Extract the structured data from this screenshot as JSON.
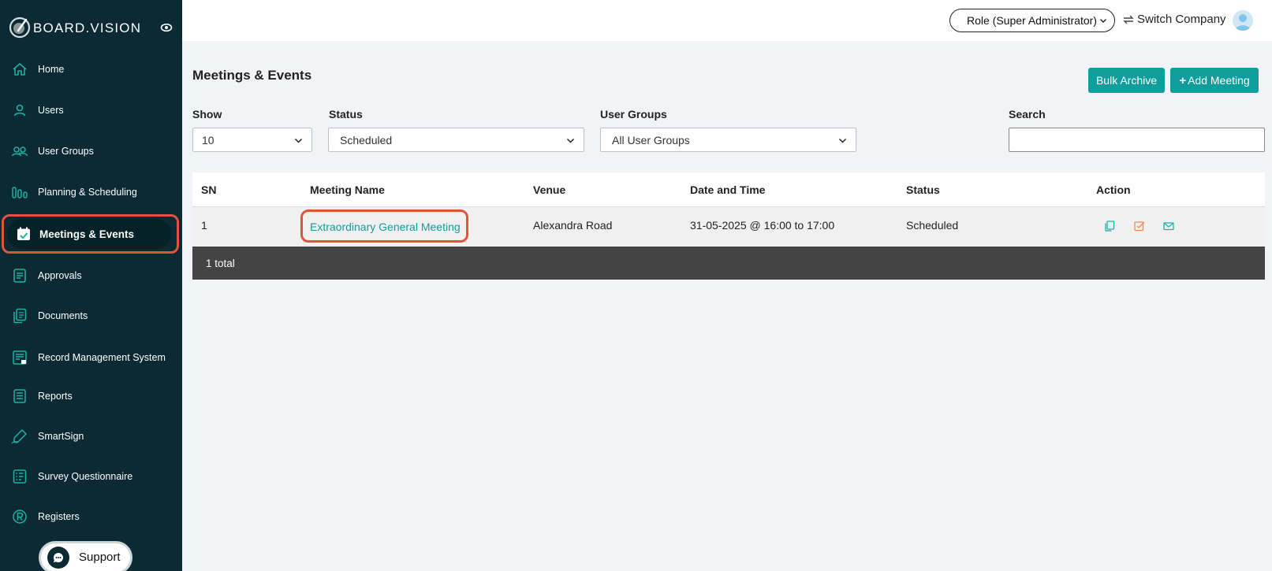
{
  "brand": {
    "name": "BOARD.VISION"
  },
  "sidebar": {
    "items": [
      {
        "label": "Home",
        "icon": "home-icon"
      },
      {
        "label": "Users",
        "icon": "user-icon"
      },
      {
        "label": "User Groups",
        "icon": "user-groups-icon"
      },
      {
        "label": "Planning & Scheduling",
        "icon": "planning-icon"
      },
      {
        "label": "Meetings & Events",
        "icon": "calendar-check-icon",
        "active": true
      },
      {
        "label": "Approvals",
        "icon": "approvals-icon"
      },
      {
        "label": "Documents",
        "icon": "documents-icon"
      },
      {
        "label": "Record Management System",
        "icon": "record-management-icon"
      },
      {
        "label": "Reports",
        "icon": "reports-icon"
      },
      {
        "label": "SmartSign",
        "icon": "smartsign-icon"
      },
      {
        "label": "Survey Questionnaire",
        "icon": "survey-icon"
      },
      {
        "label": "Registers",
        "icon": "registered-icon"
      }
    ],
    "support_label": "Support"
  },
  "topbar": {
    "role_label": "Role (Super Administrator)",
    "switch_company_label": "Switch Company"
  },
  "main": {
    "title": "Meetings & Events",
    "bulk_archive_label": "Bulk Archive",
    "add_meeting_label": "Add Meeting",
    "filters": {
      "show_label": "Show",
      "show_value": "10",
      "status_label": "Status",
      "status_value": "Scheduled",
      "user_groups_label": "User Groups",
      "user_groups_value": "All User Groups",
      "search_label": "Search",
      "search_value": ""
    },
    "table": {
      "headers": [
        "SN",
        "Meeting Name",
        "Venue",
        "Date and Time",
        "Status",
        "Action"
      ],
      "rows": [
        {
          "sn": "1",
          "meeting_name": "Extraordinary General Meeting",
          "venue": "Alexandra Road",
          "date_time": "31-05-2025 @ 16:00 to 17:00",
          "status": "Scheduled"
        }
      ],
      "footer": "1 total"
    }
  },
  "colors": {
    "sidebar_bg": "#0b2a33",
    "accent": "#0f9e9b",
    "highlight": "#e2533d",
    "footer_bg": "#444444"
  }
}
